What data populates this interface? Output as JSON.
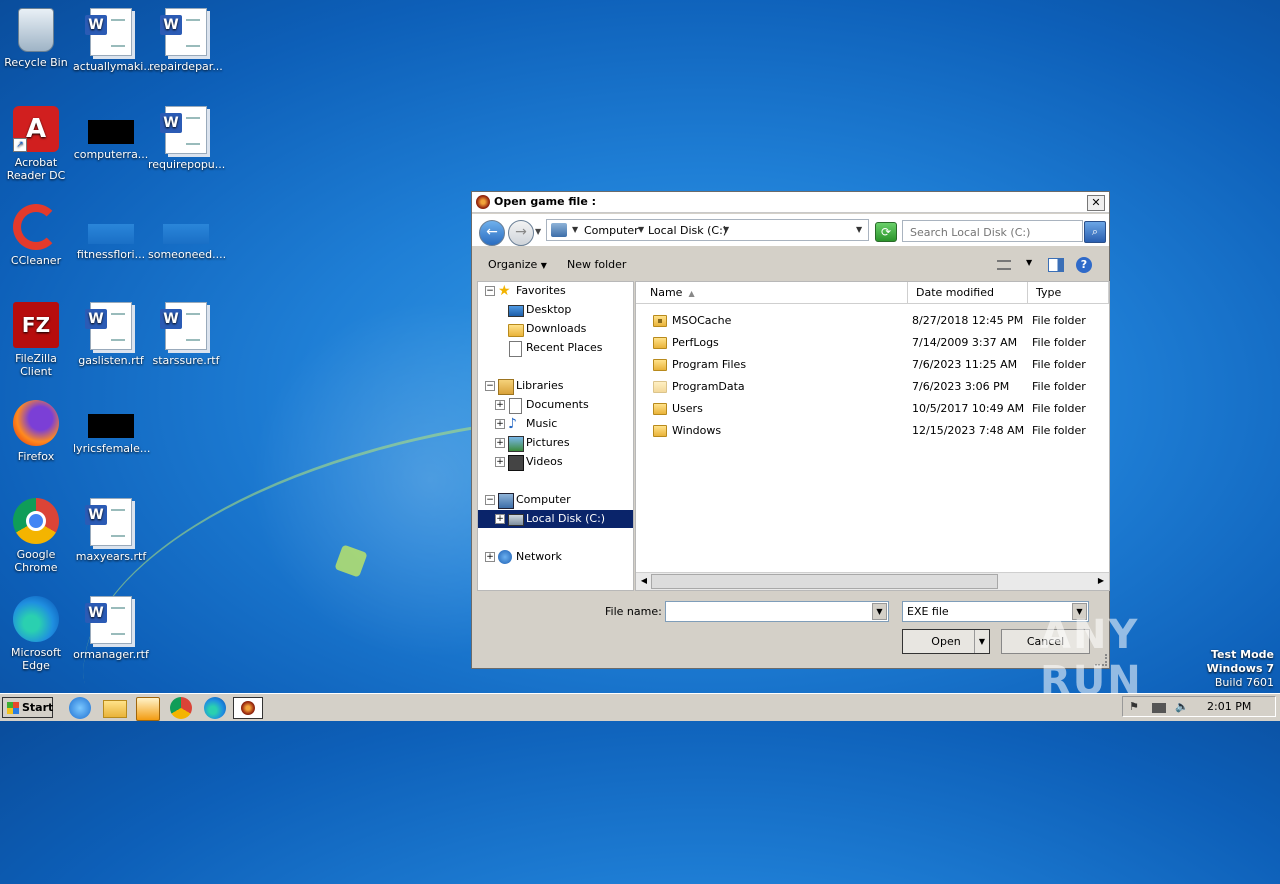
{
  "desktop": {
    "icons": [
      {
        "label": "Recycle Bin",
        "icon": "recycle-bin-icon"
      },
      {
        "label": "actuallymaki...",
        "icon": "word-document-icon"
      },
      {
        "label": "repairdepar...",
        "icon": "word-document-icon"
      },
      {
        "label": "Acrobat Reader DC",
        "icon": "acrobat-icon"
      },
      {
        "label": "computerra...",
        "icon": "black-file-icon"
      },
      {
        "label": "requirepopu...",
        "icon": "word-document-icon"
      },
      {
        "label": "CCleaner",
        "icon": "ccleaner-icon"
      },
      {
        "label": "fitnessflori...",
        "icon": "blank-file-icon"
      },
      {
        "label": "someoneed....",
        "icon": "blank-file-icon"
      },
      {
        "label": "FileZilla Client",
        "icon": "filezilla-icon"
      },
      {
        "label": "gaslisten.rtf",
        "icon": "word-document-icon"
      },
      {
        "label": "starssure.rtf",
        "icon": "word-document-icon"
      },
      {
        "label": "Firefox",
        "icon": "firefox-icon"
      },
      {
        "label": "lyricsfemale...",
        "icon": "black-file-icon"
      },
      {
        "label": "Google Chrome",
        "icon": "chrome-icon"
      },
      {
        "label": "maxyears.rtf",
        "icon": "word-document-icon"
      },
      {
        "label": "Microsoft Edge",
        "icon": "edge-icon"
      },
      {
        "label": "ormanager.rtf",
        "icon": "word-document-icon"
      }
    ]
  },
  "dialog": {
    "title": "Open game file :",
    "close_label": "✕",
    "address": {
      "crumbs": [
        "Computer",
        "Local Disk (C:)"
      ]
    },
    "search": {
      "placeholder": "Search Local Disk (C:)"
    },
    "toolbar": {
      "organize": "Organize",
      "new_folder": "New folder",
      "help": "?"
    },
    "nav": {
      "favorites": "Favorites",
      "desktop": "Desktop",
      "downloads": "Downloads",
      "recent": "Recent Places",
      "libraries": "Libraries",
      "documents": "Documents",
      "music": "Music",
      "pictures": "Pictures",
      "videos": "Videos",
      "computer": "Computer",
      "local_disk": "Local Disk (C:)",
      "network": "Network"
    },
    "columns": {
      "name": "Name",
      "date": "Date modified",
      "type": "Type"
    },
    "files": [
      {
        "name": "MSOCache",
        "date": "8/27/2018 12:45 PM",
        "type": "File folder"
      },
      {
        "name": "PerfLogs",
        "date": "7/14/2009 3:37 AM",
        "type": "File folder"
      },
      {
        "name": "Program Files",
        "date": "7/6/2023 11:25 AM",
        "type": "File folder"
      },
      {
        "name": "ProgramData",
        "date": "7/6/2023 3:06 PM",
        "type": "File folder"
      },
      {
        "name": "Users",
        "date": "10/5/2017 10:49 AM",
        "type": "File folder"
      },
      {
        "name": "Windows",
        "date": "12/15/2023 7:48 AM",
        "type": "File folder"
      }
    ],
    "filename_label": "File name:",
    "filename_value": "",
    "filetype": "EXE file",
    "open_label": "Open",
    "cancel_label": "Cancel"
  },
  "watermark": {
    "text": "ANY RUN"
  },
  "osinfo": {
    "line1": "Test Mode",
    "line2": "Windows 7",
    "line3": "Build 7601"
  },
  "taskbar": {
    "start_label": "Start",
    "clock": "2:01 PM"
  }
}
